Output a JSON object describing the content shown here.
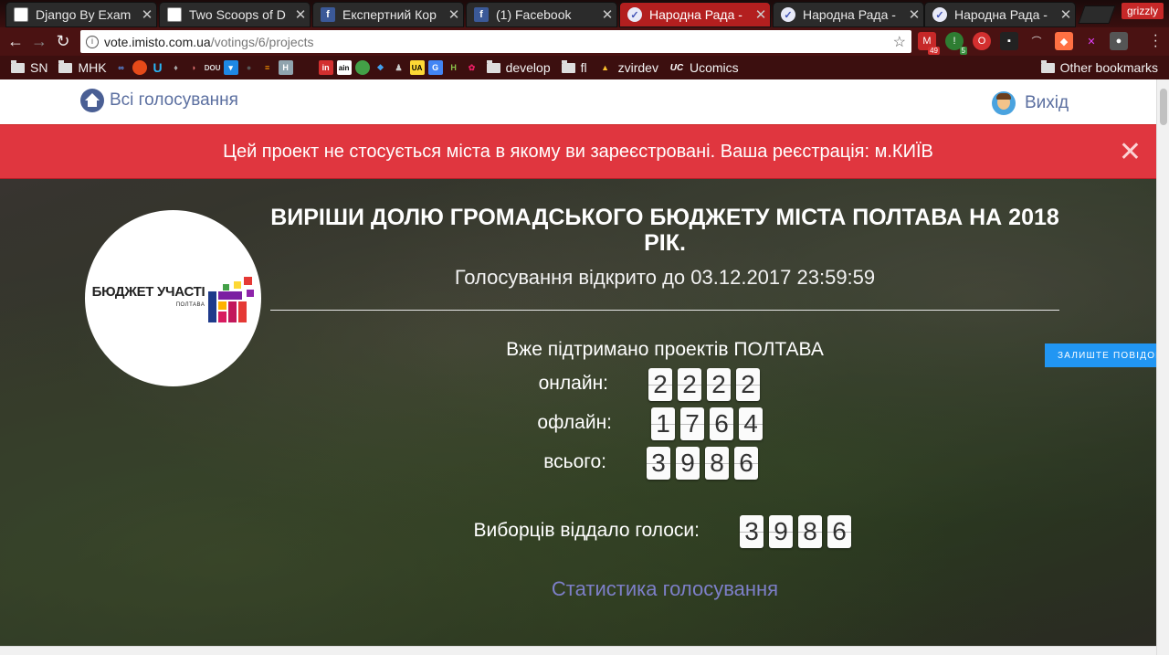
{
  "browser": {
    "tabs": [
      {
        "title": "Django By Exam",
        "favicon": "doc-icon",
        "active": false
      },
      {
        "title": "Two Scoops of D",
        "favicon": "doc-icon",
        "active": false
      },
      {
        "title": "Експертний Кор",
        "favicon": "facebook-icon",
        "active": false
      },
      {
        "title": "(1) Facebook",
        "favicon": "facebook-icon",
        "active": false
      },
      {
        "title": "Народна Рада -",
        "favicon": "check-icon",
        "active": true
      },
      {
        "title": "Народна Рада -",
        "favicon": "check-icon",
        "active": false
      },
      {
        "title": "Народна Рада -",
        "favicon": "check-icon",
        "active": false
      }
    ],
    "profile_name": "grizzly",
    "url_host": "vote.imisto.com.ua",
    "url_path": "/votings/6/projects",
    "extension_badges": {
      "gmail": "49",
      "green": "5"
    },
    "bookmarks": [
      {
        "label": "SN",
        "type": "folder"
      },
      {
        "label": "MHK",
        "type": "folder"
      },
      {
        "label": "develop",
        "type": "folder"
      },
      {
        "label": "fl",
        "type": "folder"
      },
      {
        "label": "zvirdev",
        "type": "link"
      },
      {
        "label": "Ucomics",
        "type": "link"
      }
    ],
    "other_bookmarks": "Other bookmarks"
  },
  "nav": {
    "all_votings": "Всі голосування",
    "logout": "Вихід"
  },
  "alert": {
    "message": "Цей проект не стосується міста в якому ви зареєстровані. Ваша реєстрація: м.КИЇВ",
    "close": "✕"
  },
  "logo": {
    "text": "БЮДЖЕТ УЧАСТІ",
    "subtext": "ПОЛТАВА"
  },
  "voting": {
    "title": "ВИРІШИ ДОЛЮ ГРОМАДСЬКОГО БЮДЖЕТУ МІСТА ПОЛТАВА НА 2018 РІК.",
    "open_until": "Голосування відкрито до 03.12.2017 23:59:59",
    "supported_heading": "Вже підтримано проектів ПОЛТАВА",
    "online_label": "онлайн:",
    "online_digits": [
      "2",
      "2",
      "2",
      "2"
    ],
    "offline_label": "офлайн:",
    "offline_digits": [
      "1",
      "7",
      "6",
      "4"
    ],
    "total_label": "всього:",
    "total_digits": [
      "3",
      "9",
      "8",
      "6"
    ],
    "voters_label": "Виборців віддало голоси:",
    "voters_digits": [
      "3",
      "9",
      "8",
      "6"
    ],
    "stats_link": "Статистика голосування"
  },
  "feedback_button": "ЗАЛИШТЕ ПОВІДОМ",
  "colors": {
    "alert_bg": "#e0363f",
    "link": "#5b6fa0",
    "stats_link": "#7d7fc8",
    "feedback": "#2196f3"
  }
}
